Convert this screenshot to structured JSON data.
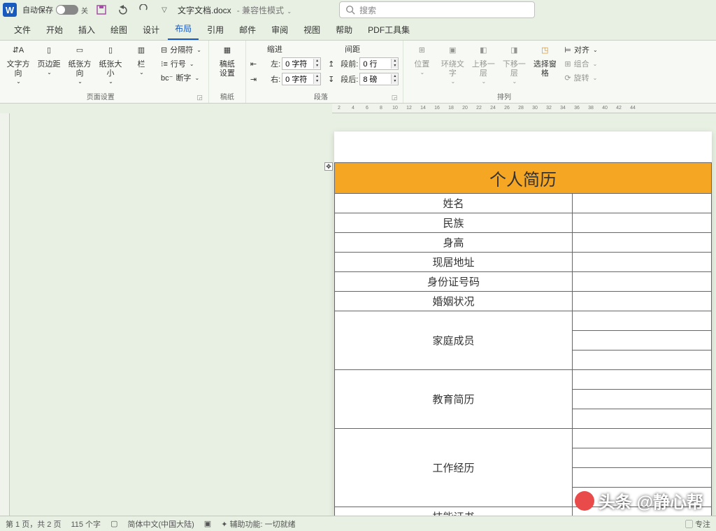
{
  "titlebar": {
    "app_badge": "W",
    "autosave_label": "自动保存",
    "autosave_state": "关",
    "doc_name": "文字文档.docx",
    "compat_mode": "兼容性模式",
    "search_placeholder": "搜索"
  },
  "tabs": [
    {
      "label": "文件"
    },
    {
      "label": "开始"
    },
    {
      "label": "插入"
    },
    {
      "label": "绘图"
    },
    {
      "label": "设计"
    },
    {
      "label": "布局",
      "active": true
    },
    {
      "label": "引用"
    },
    {
      "label": "邮件"
    },
    {
      "label": "审阅"
    },
    {
      "label": "视图"
    },
    {
      "label": "帮助"
    },
    {
      "label": "PDF工具集"
    }
  ],
  "ribbon": {
    "page_setup": {
      "group_label": "页面设置",
      "text_dir": "文字方向",
      "margin": "页边距",
      "orient": "纸张方向",
      "size": "纸张大小",
      "columns": "栏",
      "breaks": "分隔符",
      "line_no": "行号",
      "hyphen": "断字"
    },
    "draft": {
      "group_label": "稿纸",
      "btn": "稿纸\n设置"
    },
    "para": {
      "group_label": "段落",
      "indent_header": "缩进",
      "spacing_header": "间距",
      "indent_left_label": "左:",
      "indent_left_val": "0 字符",
      "indent_right_label": "右:",
      "indent_right_val": "0 字符",
      "space_before_label": "段前:",
      "space_before_val": "0 行",
      "space_after_label": "段后:",
      "space_after_val": "8 磅"
    },
    "arrange": {
      "group_label": "排列",
      "position": "位置",
      "wrap": "环绕文\n字",
      "forward": "上移一层",
      "backward": "下移一层",
      "select_pane": "选择窗格",
      "align": "对齐",
      "group_btn": "组合",
      "rotate": "旋转"
    }
  },
  "ruler_marks": [
    "2",
    "4",
    "6",
    "8",
    "10",
    "12",
    "14",
    "16",
    "18",
    "20",
    "22",
    "24",
    "26",
    "28",
    "30",
    "32",
    "34",
    "36",
    "38",
    "40",
    "42",
    "44"
  ],
  "document": {
    "title": "个人简历",
    "rows": [
      {
        "label": "姓名"
      },
      {
        "label": "民族"
      },
      {
        "label": "身高"
      },
      {
        "label": "现居地址"
      },
      {
        "label": "身份证号码"
      },
      {
        "label": "婚姻状况"
      }
    ],
    "tall_rows": [
      {
        "label": "家庭成员",
        "sub": 3
      },
      {
        "label": "教育简历",
        "sub": 3
      },
      {
        "label": "工作经历",
        "sub": 4
      },
      {
        "label": "技能证书",
        "sub": 1
      }
    ]
  },
  "statusbar": {
    "page": "第 1 页，共 2 页",
    "words": "115 个字",
    "lang": "简体中文(中国大陆)",
    "a11y": "辅助功能: 一切就绪",
    "focus": "专注"
  },
  "watermark": "头条 @静心帮"
}
